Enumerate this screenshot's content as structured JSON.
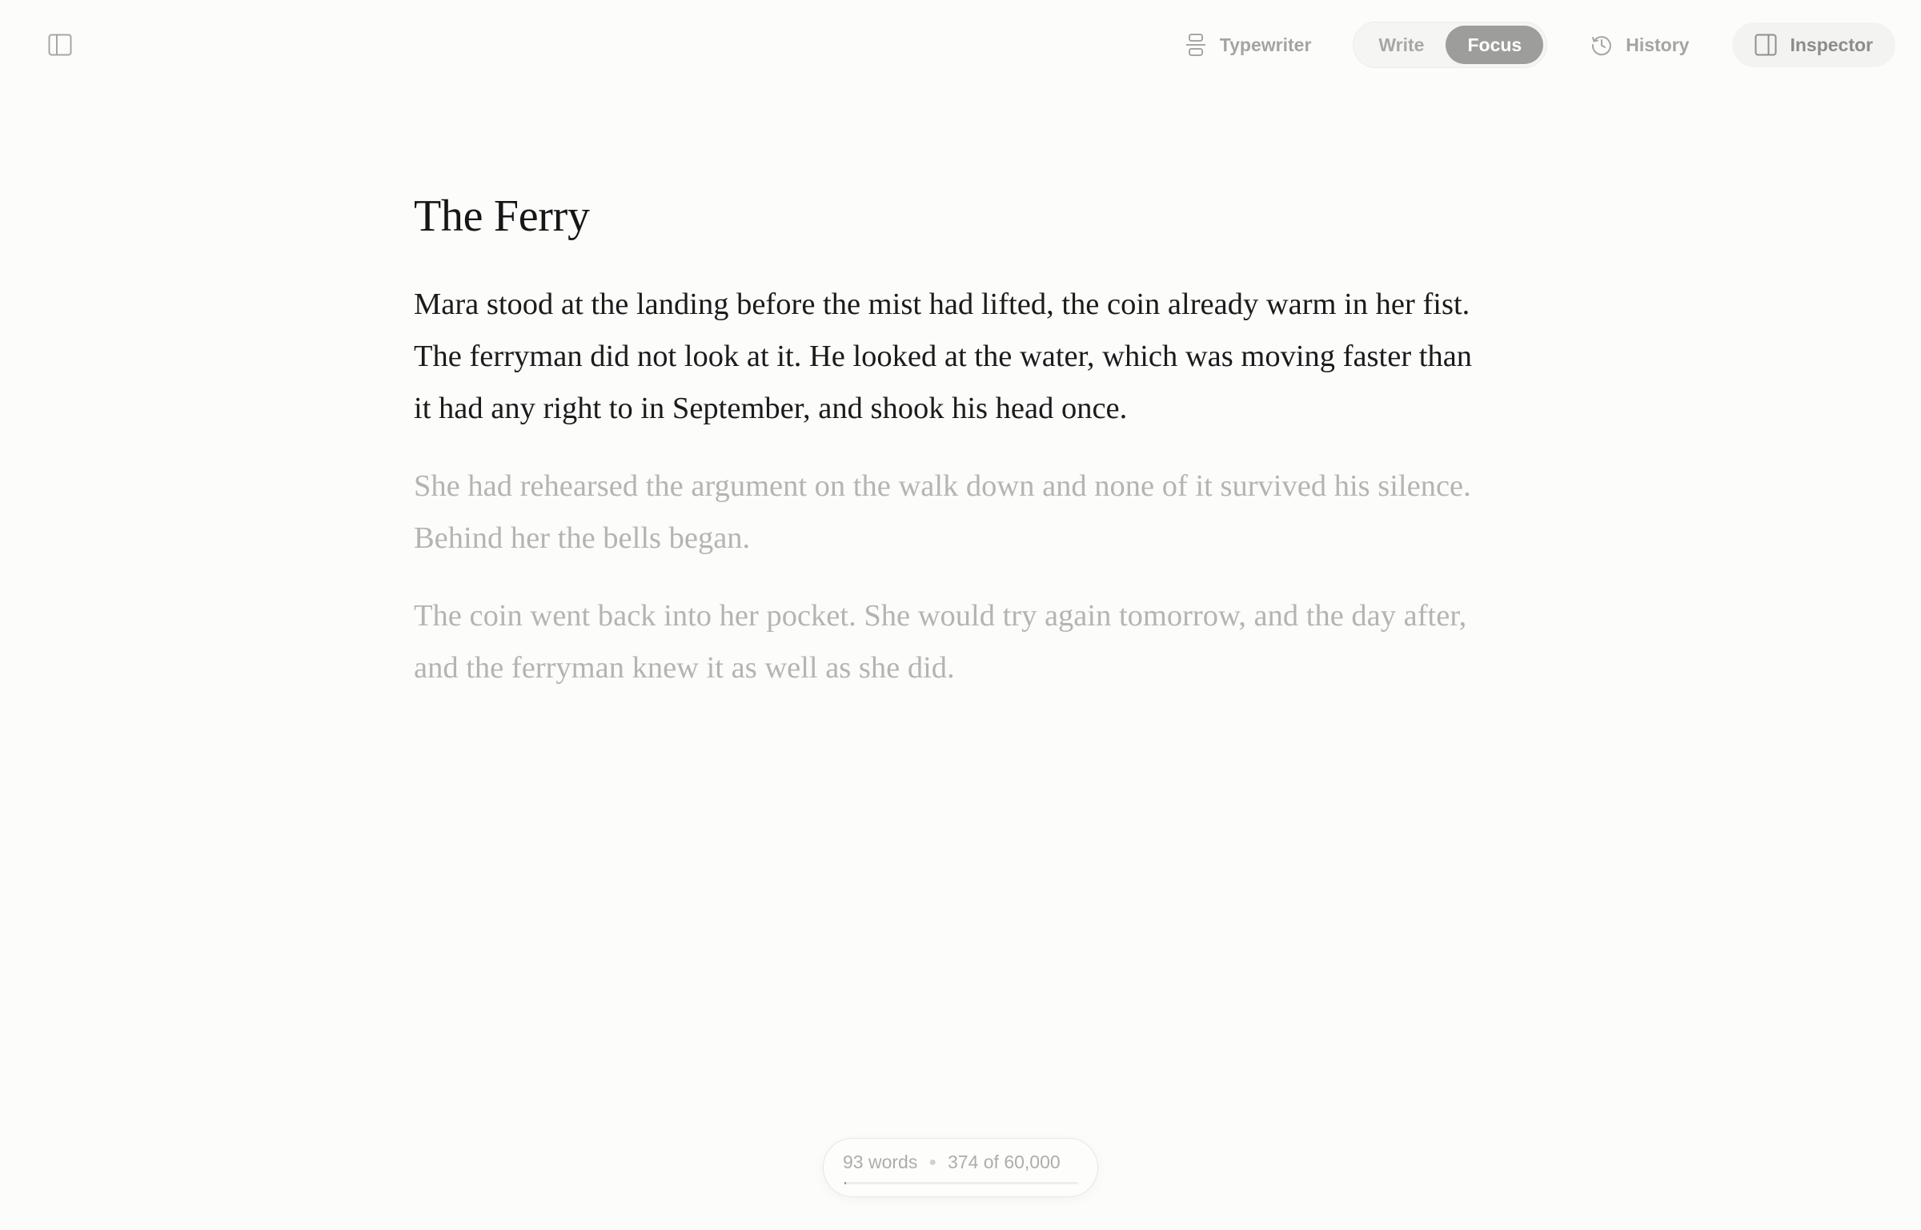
{
  "toolbar": {
    "sidebar_icon": "sidebar-icon",
    "typewriter": {
      "label": "Typewriter",
      "icon": "typewriter-icon"
    },
    "mode": {
      "options": [
        "Write",
        "Focus"
      ],
      "selected": "Focus"
    },
    "history": {
      "label": "History",
      "icon": "history-icon"
    },
    "inspector": {
      "label": "Inspector",
      "icon": "inspector-icon"
    }
  },
  "document": {
    "title": "The Ferry",
    "paragraphs": [
      {
        "text": "Mara stood at the landing before the mist had lifted, the coin already warm in her fist. The ferryman did not look at it. He looked at the water, which was moving faster than it had any right to in September, and shook his head once.",
        "focused": true
      },
      {
        "text": "She had rehearsed the argument on the walk down and none of it survived his silence. Behind her the bells began.",
        "focused": false
      },
      {
        "text": "The coin went back into her pocket. She would try again tomorrow, and the day after, and the ferryman knew it as well as she did.",
        "focused": false
      }
    ]
  },
  "status": {
    "words": "93 words",
    "progress_label": "374 of 60,000",
    "progress_fraction": 0.0062
  },
  "colors": {
    "background": "#fcfcfb",
    "text": "#1b1b1b",
    "dimmed_text": "#b4b4b2",
    "active_segment": "#9d9d9b"
  }
}
